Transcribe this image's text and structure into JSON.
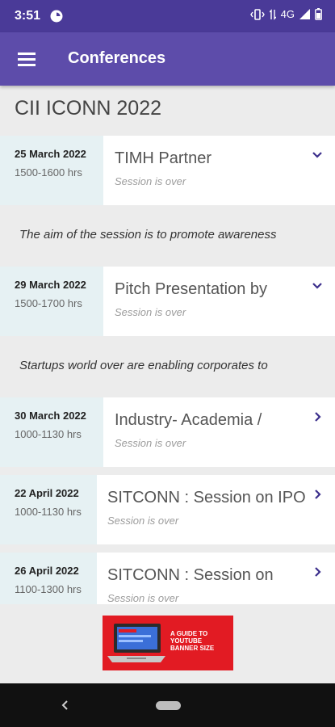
{
  "status_bar": {
    "time": "3:51",
    "network": "4G"
  },
  "app_bar": {
    "title": "Conferences"
  },
  "page": {
    "title": "CII ICONN 2022"
  },
  "sessions": [
    {
      "date": "25 March 2022",
      "time": "1500-1600 hrs",
      "title": "TIMH Partner",
      "status": "Session is over",
      "chevron": "chevron-down-icon",
      "description": "The aim of the session is to promote awareness"
    },
    {
      "date": "29 March 2022",
      "time": "1500-1700 hrs",
      "title": "Pitch Presentation by",
      "status": "Session is over",
      "chevron": "chevron-down-icon",
      "description": "Startups world over are enabling corporates to"
    },
    {
      "date": "30 March 2022",
      "time": "1000-1130 hrs",
      "title": "Industry- Academia /",
      "status": "Session is over",
      "chevron": "chevron-right-icon"
    },
    {
      "date": "22 April 2022",
      "time": "1000-1130 hrs",
      "title": "SITCONN : Session on IPO",
      "status": "Session is over",
      "chevron": "chevron-right-icon"
    },
    {
      "date": "26 April 2022",
      "time": "1100-1300 hrs",
      "title": "SITCONN : Session on",
      "status": "Session is over",
      "chevron": "chevron-right-icon"
    }
  ],
  "ad": {
    "text": "A GUIDE TO\nYOUTUBE\nBANNER SIZE"
  },
  "colors": {
    "status_bar": "#4a3a98",
    "app_bar": "#5d4caa",
    "chevron": "#3b2e8c",
    "date_panel": "#e6f1f3",
    "ad_background": "#e21b23"
  }
}
